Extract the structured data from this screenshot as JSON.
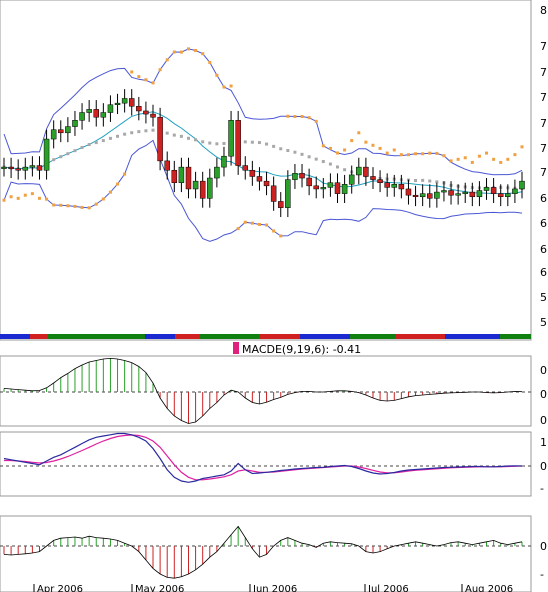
{
  "chart_data": [
    {
      "id": "price",
      "type": "candlestick",
      "y_ticks": [
        "8",
        "7",
        "7",
        "7",
        "7",
        "7",
        "7",
        "6",
        "6",
        "6",
        "6",
        "5",
        "5",
        "5"
      ],
      "ohlc_close": [
        74.8,
        74.7,
        74.6,
        74.8,
        74.9,
        74.6,
        76.6,
        77.2,
        77.0,
        77.4,
        77.8,
        78.3,
        78.5,
        78.0,
        78.3,
        78.8,
        78.9,
        79.2,
        78.7,
        78.4,
        78.2,
        78.0,
        75.2,
        74.6,
        73.8,
        74.8,
        73.4,
        73.9,
        72.8,
        74.1,
        74.8,
        75.5,
        77.8,
        74.9,
        74.6,
        74.2,
        73.9,
        73.6,
        72.6,
        72.2,
        74.0,
        74.4,
        74.1,
        73.6,
        73.4,
        73.5,
        73.8,
        73.1,
        73.7,
        74.3,
        74.8,
        74.2,
        74.0,
        73.8,
        73.5,
        73.7,
        73.4,
        73.0,
        72.9,
        73.1,
        72.8,
        73.2,
        73.3,
        73.0,
        73.1,
        73.2,
        72.9,
        73.3,
        73.5,
        73.1,
        72.9,
        73.1,
        73.4,
        73.9
      ],
      "bollinger_note": "upper / middle / lower bands drawn as lines",
      "parabolic_sar": "orange dotted",
      "moving_average": "grey dotted",
      "trend_bar": "blue / red / green segments",
      "x_labels": [
        "Apr 2006",
        "May 2006",
        "Jun 2006",
        "Jul 2006",
        "Aug 2006"
      ]
    },
    {
      "id": "macd-histogram",
      "type": "bar",
      "legend": "MACDE(9,19,6): -0.41",
      "y_ticks": [
        "0",
        "0",
        "0"
      ],
      "values": [
        0.12,
        0.1,
        0.08,
        0.06,
        0.04,
        0.05,
        0.14,
        0.3,
        0.48,
        0.62,
        0.78,
        0.9,
        1.0,
        1.05,
        1.1,
        1.12,
        1.1,
        1.05,
        0.98,
        0.85,
        0.65,
        0.3,
        -0.2,
        -0.55,
        -0.8,
        -0.95,
        -1.05,
        -1.0,
        -0.8,
        -0.55,
        -0.35,
        -0.1,
        0.06,
        0.0,
        -0.2,
        -0.35,
        -0.4,
        -0.34,
        -0.25,
        -0.18,
        -0.08,
        -0.02,
        0.02,
        0.02,
        0.0,
        0.0,
        0.02,
        0.04,
        0.04,
        0.02,
        -0.02,
        -0.1,
        -0.2,
        -0.28,
        -0.3,
        -0.28,
        -0.22,
        -0.16,
        -0.12,
        -0.1,
        -0.08,
        -0.06,
        -0.04,
        -0.03,
        -0.02,
        -0.01,
        0.0,
        0.0,
        -0.02,
        -0.03,
        -0.02,
        0.0,
        0.02,
        0.01
      ]
    },
    {
      "id": "macd-lines",
      "type": "line",
      "y_ticks": [
        "1",
        "0",
        "0",
        "-"
      ],
      "macd": [
        0.3,
        0.25,
        0.2,
        0.15,
        0.1,
        0.05,
        0.2,
        0.35,
        0.45,
        0.6,
        0.75,
        0.9,
        1.05,
        1.15,
        1.2,
        1.25,
        1.3,
        1.3,
        1.25,
        1.15,
        1.0,
        0.7,
        0.3,
        -0.15,
        -0.45,
        -0.6,
        -0.65,
        -0.6,
        -0.5,
        -0.45,
        -0.4,
        -0.35,
        -0.2,
        0.1,
        -0.15,
        -0.3,
        -0.28,
        -0.25,
        -0.22,
        -0.18,
        -0.15,
        -0.12,
        -0.1,
        -0.08,
        -0.06,
        -0.05,
        -0.02,
        0.0,
        0.02,
        -0.02,
        -0.1,
        -0.2,
        -0.28,
        -0.32,
        -0.3,
        -0.26,
        -0.2,
        -0.16,
        -0.14,
        -0.12,
        -0.1,
        -0.08,
        -0.06,
        -0.05,
        -0.04,
        -0.03,
        -0.02,
        -0.02,
        -0.03,
        -0.03,
        -0.02,
        0.0,
        0.01,
        0.0
      ],
      "signal": [
        0.22,
        0.22,
        0.2,
        0.18,
        0.15,
        0.12,
        0.14,
        0.2,
        0.28,
        0.38,
        0.5,
        0.62,
        0.75,
        0.88,
        1.0,
        1.1,
        1.18,
        1.22,
        1.24,
        1.22,
        1.15,
        1.0,
        0.75,
        0.4,
        0.05,
        -0.25,
        -0.45,
        -0.55,
        -0.55,
        -0.52,
        -0.48,
        -0.43,
        -0.35,
        -0.2,
        -0.15,
        -0.2,
        -0.25,
        -0.25,
        -0.24,
        -0.21,
        -0.18,
        -0.15,
        -0.12,
        -0.1,
        -0.08,
        -0.06,
        -0.04,
        -0.02,
        0.0,
        0.0,
        -0.04,
        -0.1,
        -0.17,
        -0.24,
        -0.27,
        -0.27,
        -0.24,
        -0.2,
        -0.17,
        -0.15,
        -0.13,
        -0.11,
        -0.09,
        -0.07,
        -0.06,
        -0.05,
        -0.04,
        -0.03,
        -0.03,
        -0.03,
        -0.03,
        -0.02,
        -0.01,
        0.0
      ]
    },
    {
      "id": "oscillator",
      "type": "bar",
      "y_ticks": [
        "0",
        "-"
      ],
      "values": [
        -0.3,
        -0.32,
        -0.3,
        -0.28,
        -0.25,
        -0.2,
        0.0,
        0.2,
        0.28,
        0.3,
        0.32,
        0.28,
        0.35,
        0.3,
        0.28,
        0.25,
        0.2,
        0.1,
        0.0,
        -0.2,
        -0.5,
        -0.8,
        -1.0,
        -1.12,
        -1.15,
        -1.1,
        -1.0,
        -0.85,
        -0.65,
        -0.4,
        -0.2,
        0.1,
        0.4,
        0.7,
        0.3,
        -0.1,
        -0.4,
        -0.3,
        0.0,
        0.2,
        0.3,
        0.2,
        0.1,
        0.05,
        -0.05,
        0.1,
        0.15,
        0.12,
        0.1,
        0.08,
        0.0,
        -0.2,
        -0.25,
        -0.2,
        -0.1,
        0.0,
        0.05,
        0.1,
        0.15,
        0.1,
        0.05,
        0.0,
        0.05,
        0.12,
        0.15,
        0.1,
        0.05,
        0.1,
        0.15,
        0.2,
        0.1,
        0.05,
        0.1,
        0.15
      ]
    }
  ],
  "colors": {
    "up": "#2aa02a",
    "down": "#cc2222",
    "band": "#4a57d4",
    "sar": "#f0a040",
    "ma": "#a8a8a8",
    "mid": "#20a0c0",
    "macd": "#2a2aa0",
    "signal": "#e020a0",
    "legend_swatch": "#e0207a",
    "hist_up": "#2aa02a",
    "hist_down": "#cc2222",
    "bar_blue": "#1a2ad0",
    "bar_red": "#d02020",
    "bar_green": "#108010"
  }
}
